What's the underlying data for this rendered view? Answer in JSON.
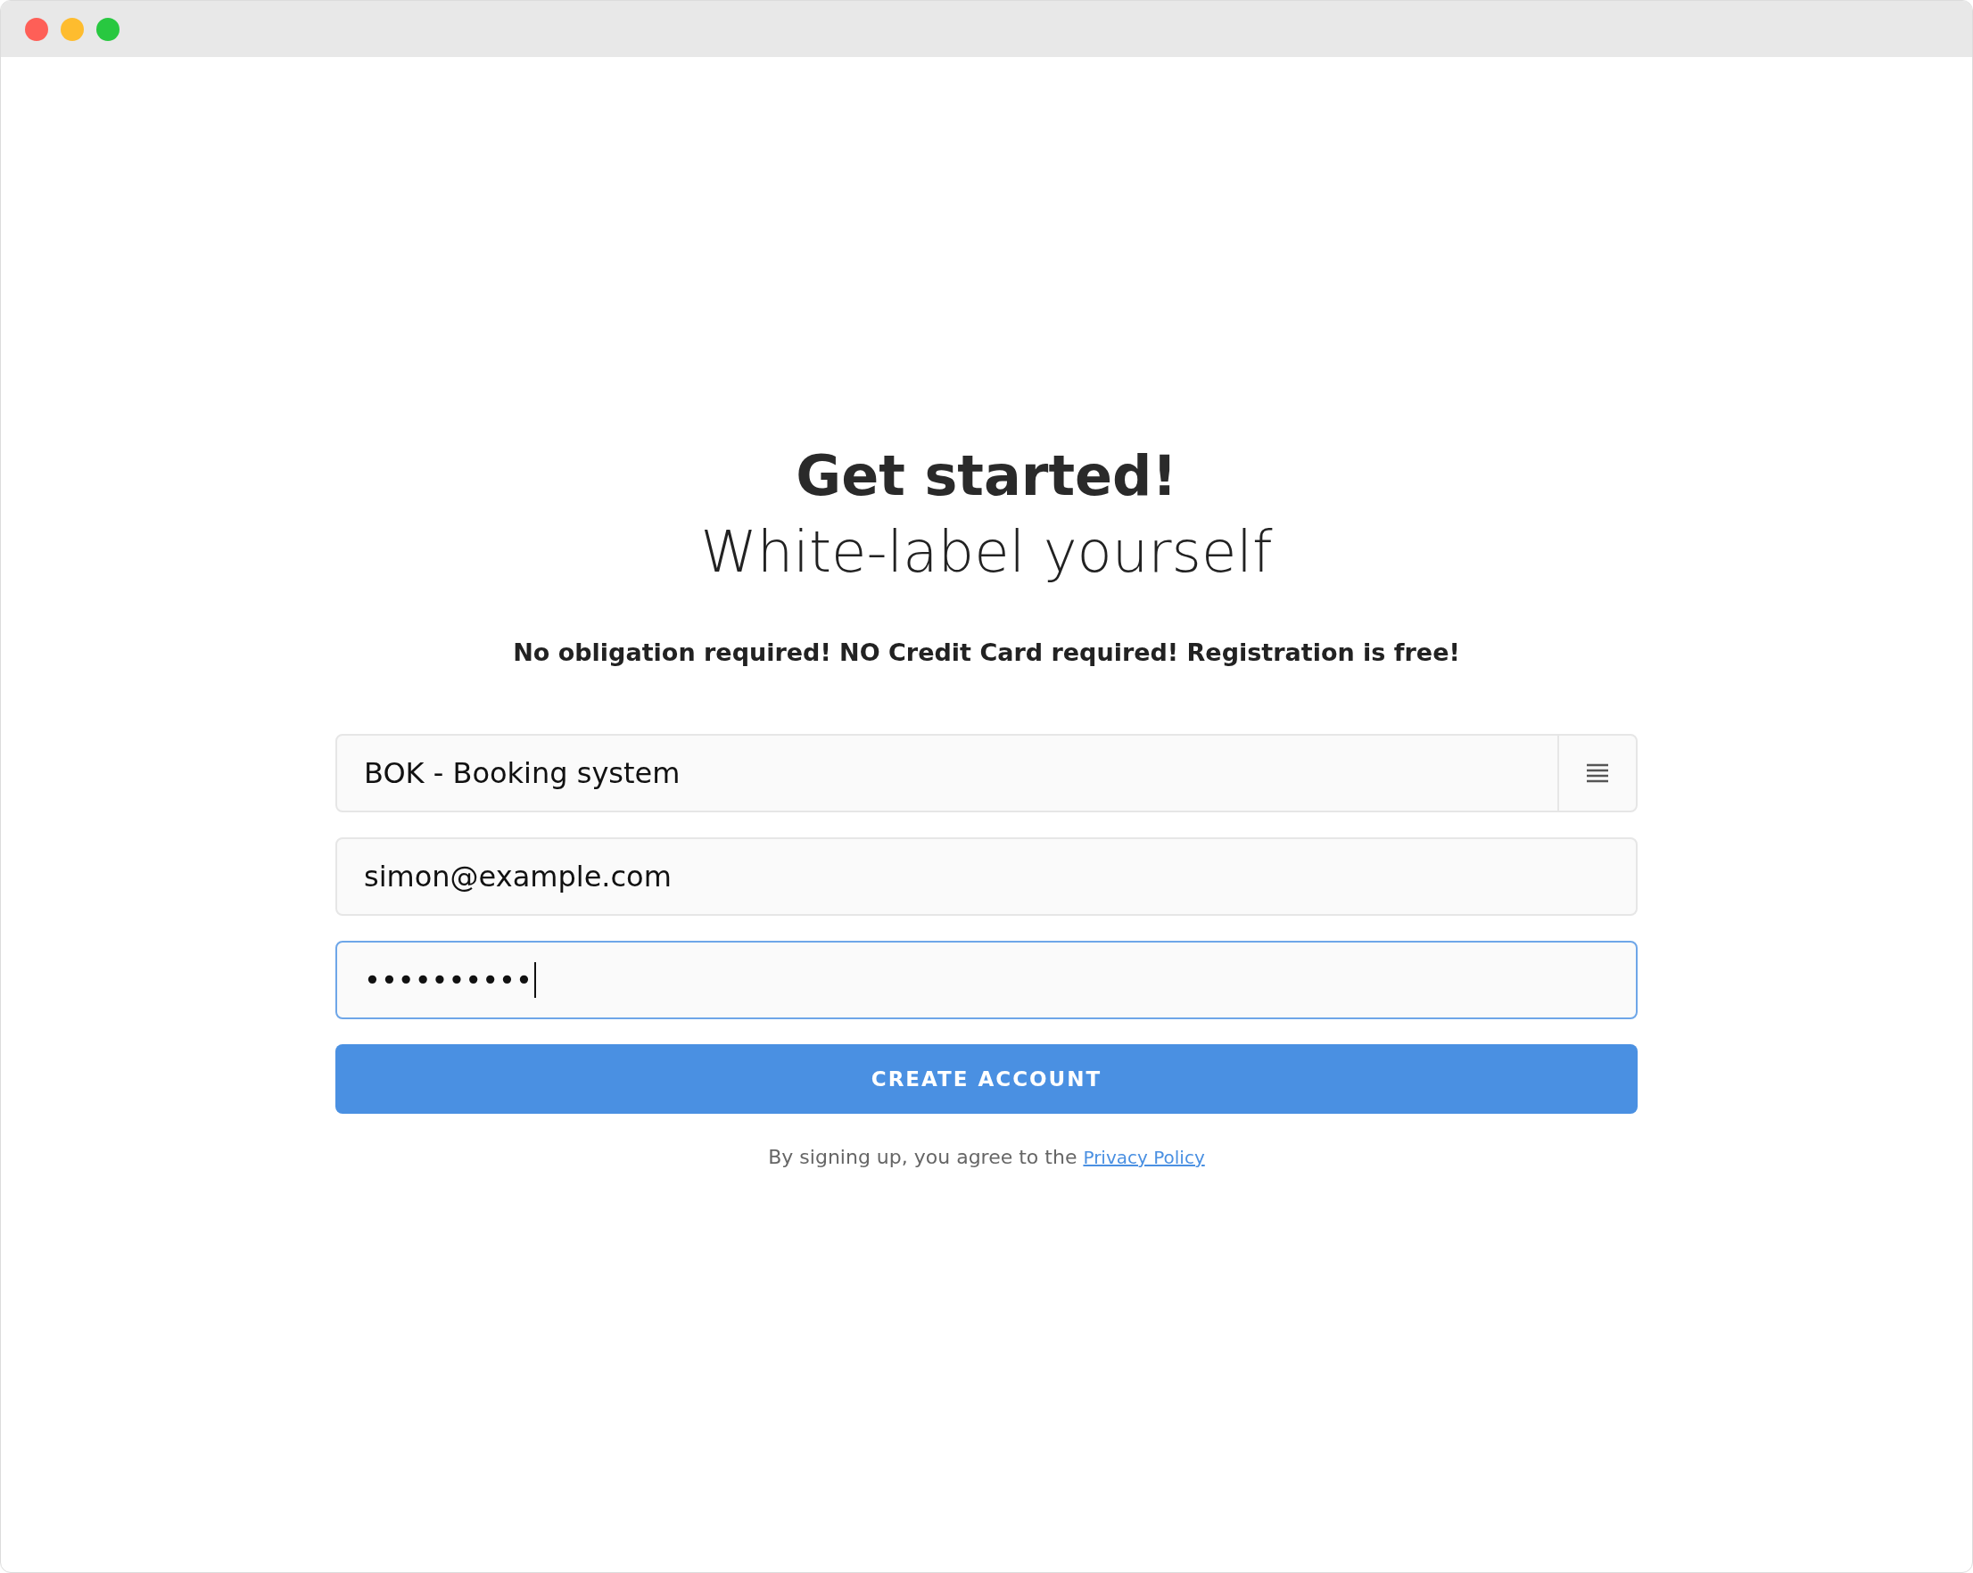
{
  "heading": "Get started!",
  "subheading": "White-label yourself",
  "notice": "No obligation required! NO Credit Card required! Registration is free!",
  "fields": [
    {
      "kind": "select",
      "value": "BOK - Booking system",
      "focused": false
    },
    {
      "kind": "text",
      "value": "simon@example.com",
      "focused": false
    },
    {
      "kind": "password",
      "value": "••••••••••",
      "focused": true
    }
  ],
  "button": "CREATE ACCOUNT",
  "consent": {
    "text": "By signing up, you agree to the",
    "link": "Privacy Policy"
  }
}
